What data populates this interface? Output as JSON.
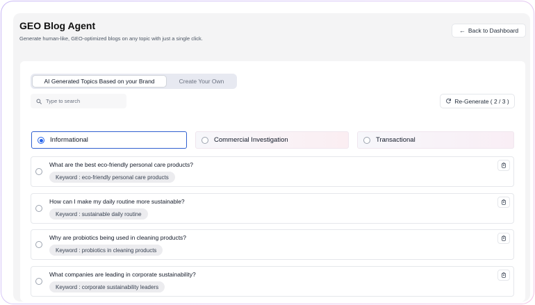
{
  "header": {
    "title": "GEO Blog Agent",
    "subtitle": "Generate human-like, GEO-optimized blogs on any topic with just a single click.",
    "back_button": "Back to Dashboard"
  },
  "toggle": {
    "active_label": "AI Generated Topics Based on your Brand",
    "inactive_label": "Create Your Own"
  },
  "search": {
    "placeholder": "Type to search",
    "value": ""
  },
  "regenerate": {
    "label": "Re-Generate ( 2 / 3 )"
  },
  "intents": [
    {
      "label": "Informational",
      "selected": true
    },
    {
      "label": "Commercial Investigation",
      "selected": false
    },
    {
      "label": "Transactional",
      "selected": false
    }
  ],
  "questions": [
    {
      "question": "What are the best eco-friendly personal care products?",
      "keyword": "Keyword : eco-friendly personal care products"
    },
    {
      "question": "How can I make my daily routine more sustainable?",
      "keyword": "Keyword : sustainable daily routine"
    },
    {
      "question": "Why are probiotics being used in cleaning products?",
      "keyword": "Keyword : probiotics in cleaning products"
    },
    {
      "question": "What companies are leading in corporate sustainability?",
      "keyword": "Keyword : corporate sustainability leaders"
    }
  ],
  "colors": {
    "accent": "#2563eb",
    "frame_gradient_start": "#c9b8f5",
    "frame_gradient_end": "#f3c4e6"
  }
}
